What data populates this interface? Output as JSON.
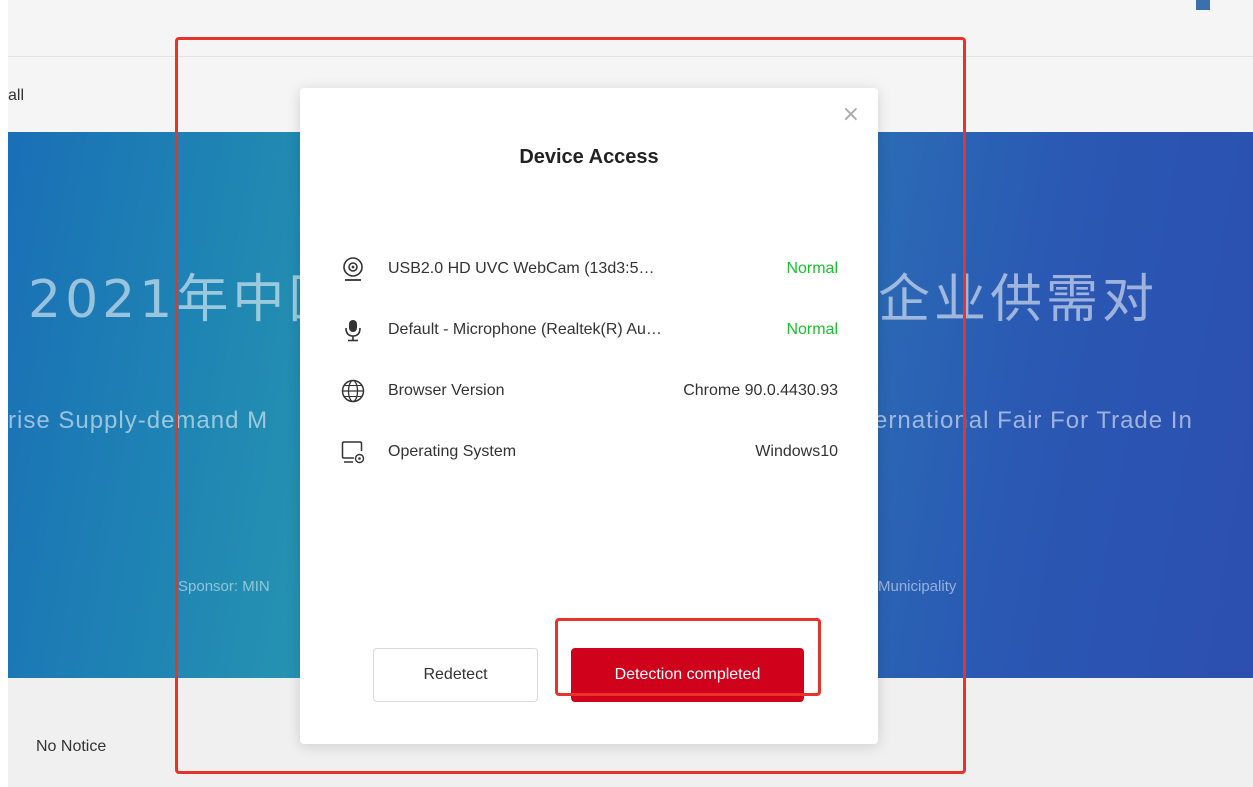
{
  "page": {
    "subbar_text": "all",
    "banner": {
      "cn_title_left": "2021年中国",
      "cn_title_right": "企业供需对",
      "en_left": "rise Supply-demand M",
      "en_right": "ernational Fair For Trade In",
      "sponsor_left": "Sponsor: MIN",
      "sponsor_right": "Municipality"
    },
    "notice": "No Notice"
  },
  "modal": {
    "title": "Device Access",
    "close_glyph": "×",
    "rows": [
      {
        "icon": "webcam-icon",
        "label": "USB2.0 HD UVC WebCam (13d3:5…",
        "value": "Normal",
        "status": "ok"
      },
      {
        "icon": "microphone-icon",
        "label": "Default - Microphone (Realtek(R) Au…",
        "value": "Normal",
        "status": "ok"
      },
      {
        "icon": "globe-icon",
        "label": "Browser Version",
        "value": "Chrome 90.0.4430.93",
        "status": "info"
      },
      {
        "icon": "monitor-settings-icon",
        "label": "Operating System",
        "value": "Windows10",
        "status": "info"
      }
    ],
    "buttons": {
      "redetect": "Redetect",
      "complete": "Detection completed"
    }
  },
  "colors": {
    "primary_red": "#d0021b",
    "status_green": "#1bbf2f",
    "annotation_red": "#e8332b"
  }
}
